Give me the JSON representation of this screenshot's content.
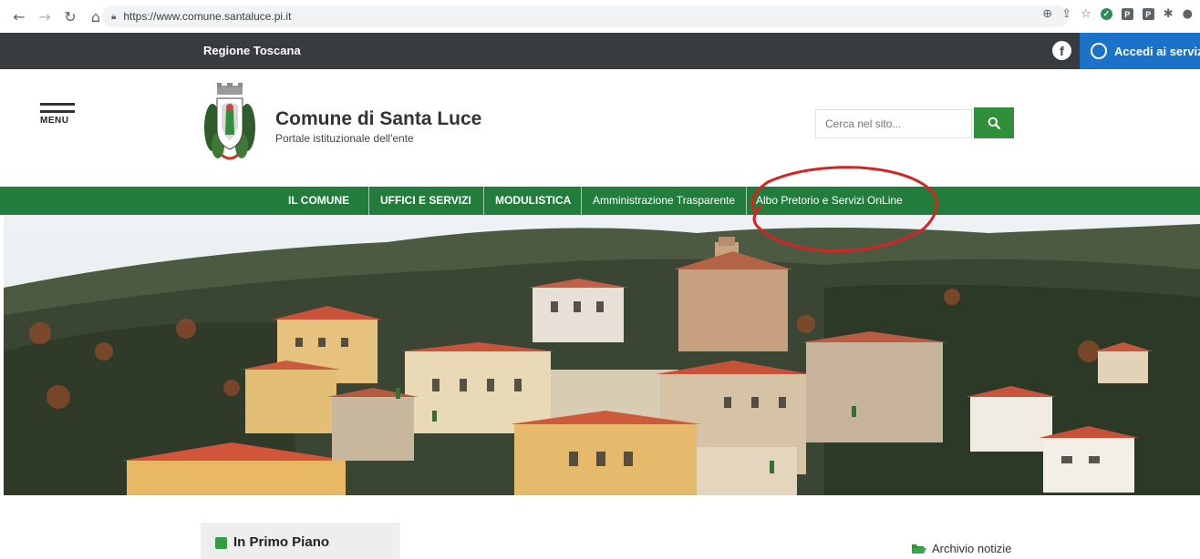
{
  "browser": {
    "url": "https://www.comune.santaluce.pi.it",
    "nav_icons": [
      "back-icon",
      "forward-icon",
      "reload-icon",
      "home-icon"
    ],
    "toolbar_icons": [
      "zoom-icon",
      "share-icon",
      "bookmark-star-icon",
      "extension-icon",
      "extension-icon",
      "extension-icon",
      "puzzle-icon",
      "profile-icon"
    ]
  },
  "topbar": {
    "region": "Regione Toscana",
    "facebook_label": "f",
    "login": "Accedi ai serviz"
  },
  "header": {
    "menu_label": "MENU",
    "title": "Comune di Santa Luce",
    "subtitle": "Portale istituzionale dell'ente",
    "search_placeholder": "Cerca nel sito..."
  },
  "nav": {
    "items": [
      "IL COMUNE",
      "UFFICI E SERVIZI",
      "MODULISTICA",
      "Amministrazione Trasparente",
      "Albo Pretorio e Servizi OnLine"
    ]
  },
  "content": {
    "primo_piano": "In Primo Piano",
    "archivio": "Archivio notizie"
  },
  "colors": {
    "nav_green": "#227d3d",
    "search_green": "#2f8f3a",
    "topbar_dark": "#383c3f",
    "login_blue": "#1a73c8",
    "highlight_red": "#d42323"
  }
}
